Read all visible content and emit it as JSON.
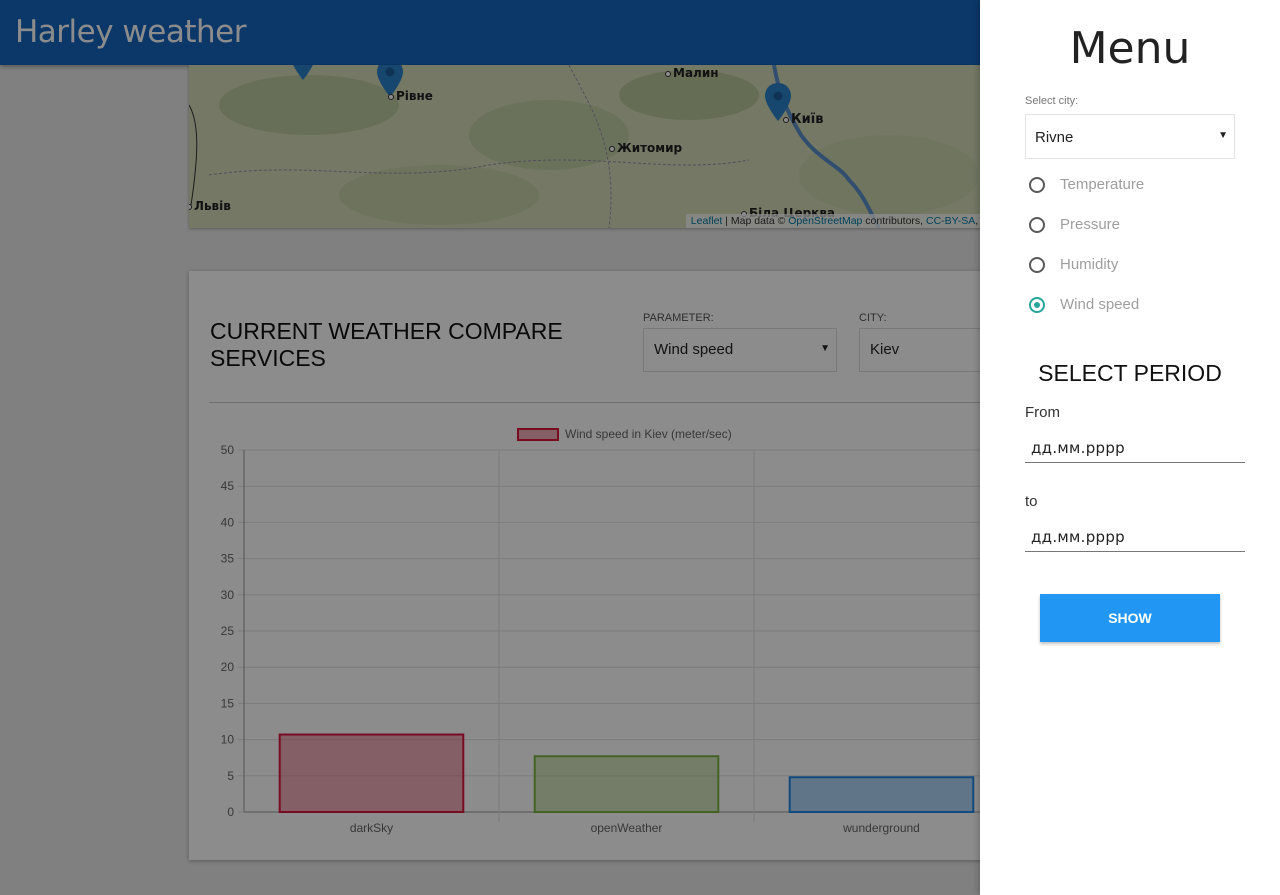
{
  "app": {
    "title": "Harley weather"
  },
  "map": {
    "cities": [
      {
        "name": "Рівне"
      },
      {
        "name": "Малин"
      },
      {
        "name": "Київ"
      },
      {
        "name": "Житомир"
      },
      {
        "name": "Львів"
      },
      {
        "name": "Біла Церква"
      }
    ],
    "attribution": {
      "leaflet": "Leaflet",
      "text1": " | Map data © ",
      "osm": "OpenStreetMap",
      "text2": " contributors, ",
      "license": "CC-BY-SA",
      "text3": ", I"
    }
  },
  "compare": {
    "heading": "CURRENT WEATHER COMPARE SERVICES",
    "parameter_label": "PARAMETER:",
    "parameter_value": "Wind speed",
    "city_label": "CITY:",
    "city_value": "Kiev"
  },
  "chart_data": {
    "type": "bar",
    "categories": [
      "darkSky",
      "openWeather",
      "wunderground"
    ],
    "series": [
      {
        "name": "Wind speed in Kiev (meter/sec)",
        "values": [
          10.7,
          7.7,
          4.8
        ]
      }
    ],
    "bar_colors": [
      "#dc143c",
      "#7cb342",
      "#1e88e5"
    ],
    "ylim": [
      0,
      50
    ],
    "yticks": [
      0,
      5,
      10,
      15,
      20,
      25,
      30,
      35,
      40,
      45,
      50
    ],
    "grid": true,
    "legend": "top"
  },
  "menu": {
    "title": "Menu",
    "select_city_label": "Select city:",
    "selected_city": "Rivne",
    "options": [
      {
        "label": "Temperature",
        "checked": false
      },
      {
        "label": "Pressure",
        "checked": false
      },
      {
        "label": "Humidity",
        "checked": false
      },
      {
        "label": "Wind speed",
        "checked": true
      }
    ],
    "period_title": "SELECT PERIOD",
    "from_label": "From",
    "from_placeholder": "дд.мм.рррр",
    "to_label": "to",
    "to_placeholder": "дд.мм.рррр",
    "show_button": "SHOW",
    "accent": "#26a69a",
    "button_color": "#2196f3"
  },
  "colors": {
    "appbar": "#1565c0"
  }
}
